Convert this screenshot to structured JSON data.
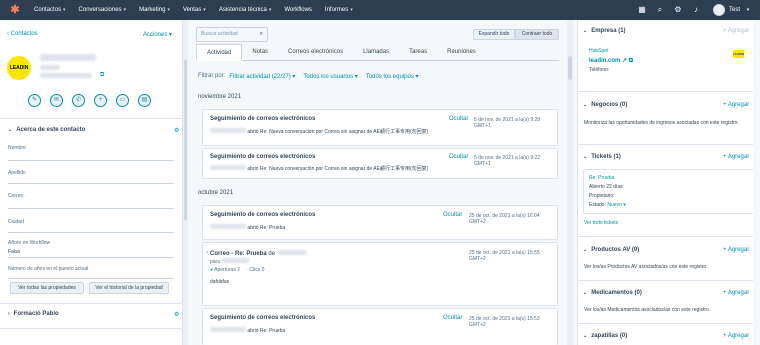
{
  "nav": {
    "items": [
      "Contactos",
      "Conversaciones",
      "Marketing",
      "Ventas",
      "Asistencia técnica",
      "Workflows",
      "Informes"
    ],
    "user": "Test"
  },
  "left": {
    "back": "Contactos",
    "actions": "Acciones",
    "logo_text": "LEADIN",
    "about_title": "Acerca de este contacto",
    "props": {
      "nombre": "Nombre",
      "apellido": "Apellido",
      "correo": "Correo",
      "ciudad": "Ciudad",
      "workflow": "Añore en Workflow",
      "workflow_value": "Falso",
      "years": "Número de años en el puesto actual"
    },
    "btn_all_props": "Ver todas las propiedades",
    "btn_history": "Ver el historial de la propiedad",
    "formacio": "Formació Pablo"
  },
  "middle": {
    "search_placeholder": "Buscar actividad",
    "expand": "Expandir todo",
    "collapse": "Contraer todo",
    "tabs": [
      "Actividad",
      "Notas",
      "Correos electrónicos",
      "Llamadas",
      "Tareas",
      "Reuniones"
    ],
    "filter_label": "Filtrar por:",
    "filter_activity": "Filtrar actividad (22/27)",
    "filter_users": "Todos los usuarios",
    "filter_teams": "Todos los equipos",
    "month1": "noviembre 2021",
    "month2": "octubre 2021",
    "cards": [
      {
        "title": "Seguimiento de correos electrónicos",
        "hide": "Ocultar",
        "date": "5 de nov. de 2021 a la(s) 9:28 GMT+1",
        "body": "abrió Re: Nueva conversación por Correo sin asignar de AE顧行工事专用(勿回复)"
      },
      {
        "title": "Seguimiento de correos electrónicos",
        "hide": "Ocultar",
        "date": "5 de nov. de 2021 a la(s) 9:22 GMT+1",
        "body": "abrió Re: Nueva conversación por Correo sin asignar de AE顧行工事专用(勿回复)"
      },
      {
        "title": "Seguimiento de correos electrónicos",
        "hide": "Ocultar",
        "date": "25 de oct. de 2021 a la(s) 16:04 GMT+2",
        "body": "abrió Re: Prueba"
      },
      {
        "title": "Correo - Re: Prueba",
        "title_suffix": "de",
        "para": "para",
        "date": "25 de oct. de 2021 a la(s) 15:55 GMT+2",
        "opens": "Aperturas 2",
        "clicks": "Clics 0",
        "body": "dafdafas"
      },
      {
        "title": "Seguimiento de correos electrónicos",
        "hide": "Ocultar",
        "date": "25 de oct. de 2021 a la(s) 15:53 GMT+2",
        "body": "abrió Re: Prueba"
      }
    ]
  },
  "right": {
    "empresa": {
      "title": "Empresa (1)",
      "add": "+ Agregar",
      "name": "HubSpot",
      "domain": "leadin.com",
      "phone": "Teléfono:",
      "logo": "LEADIN"
    },
    "negocios": {
      "title": "Negocios (0)",
      "add": "+ Agregar",
      "text": "Monitoriza las oportunidades de ingresos asociadas con este registro."
    },
    "tickets": {
      "title": "Tickets (1)",
      "add": "+ Agregar",
      "ticket": "Re: Prueba",
      "open": "Abierto 22 días",
      "owner": "Propietario:",
      "state_label": "Estado:",
      "state": "Nuevo",
      "view_all": "Ver todo tickets"
    },
    "productos": {
      "title": "Productos AV (0)",
      "add": "+ Agregar",
      "text": "Ver los/as Productos AV asociados/as con este registro."
    },
    "medicamentos": {
      "title": "Medicamentos (0)",
      "add": "+ Agregar",
      "text": "Ver los/as Medicamentos asociados/as con este registro."
    },
    "zapatillas": {
      "title": "zapatillas (0)",
      "add": "+ Agregar"
    }
  }
}
